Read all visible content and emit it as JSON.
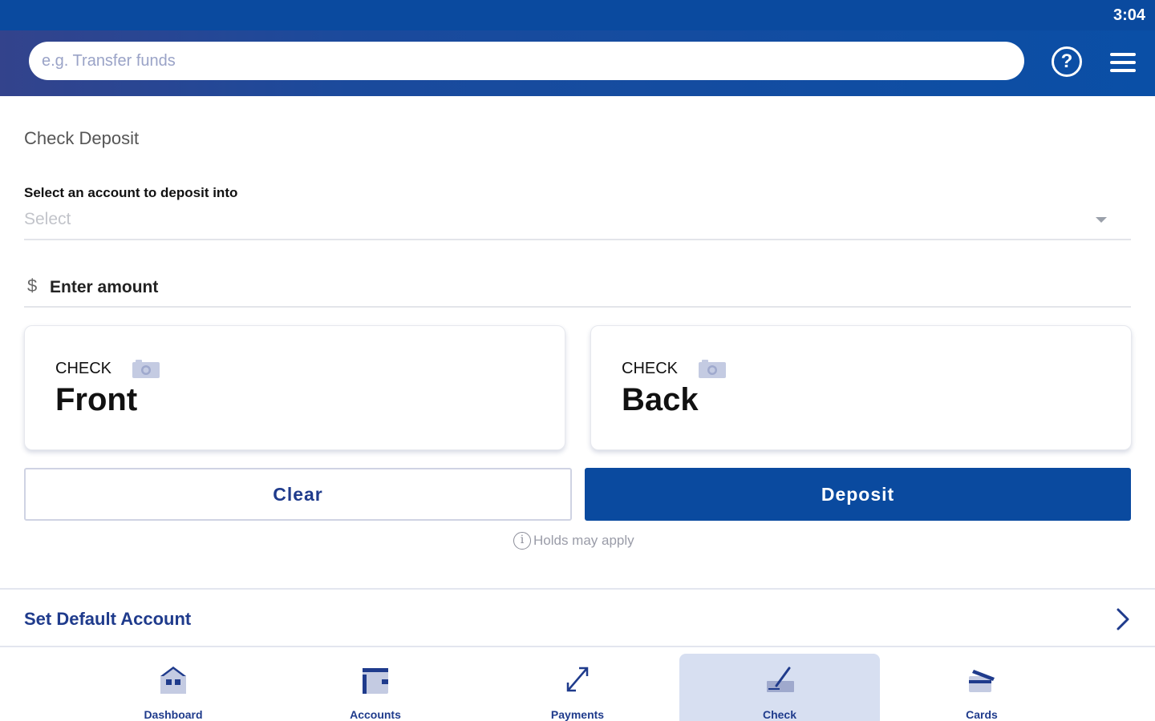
{
  "status_bar": {
    "time": "3:04"
  },
  "header": {
    "search_placeholder": "e.g. Transfer funds",
    "help_icon": "help-circle-icon",
    "menu_icon": "hamburger-menu-icon"
  },
  "page": {
    "title": "Check Deposit",
    "account_label": "Select an account to deposit into",
    "account_value": "Select",
    "amount_symbol": "$",
    "amount_placeholder": "Enter amount"
  },
  "cards": {
    "front": {
      "small": "CHECK",
      "big": "Front",
      "icon": "camera-icon"
    },
    "back": {
      "small": "CHECK",
      "big": "Back",
      "icon": "camera-icon"
    }
  },
  "actions": {
    "clear_label": "Clear",
    "deposit_label": "Deposit",
    "holds_note": "Holds may apply"
  },
  "default_account": {
    "label": "Set Default Account"
  },
  "nav": {
    "items": [
      {
        "label": "Dashboard",
        "icon": "house-icon",
        "active": false
      },
      {
        "label": "Accounts",
        "icon": "wallet-icon",
        "active": false
      },
      {
        "label": "Payments",
        "icon": "arrows-expand-icon",
        "active": false
      },
      {
        "label": "Check",
        "icon": "check-pen-icon",
        "active": true
      },
      {
        "label": "Cards",
        "icon": "cards-icon",
        "active": false
      }
    ]
  },
  "colors": {
    "brand_blue": "#0a4a9f",
    "nav_text": "#1f3b8c",
    "active_nav_bg": "#d7dff1"
  }
}
